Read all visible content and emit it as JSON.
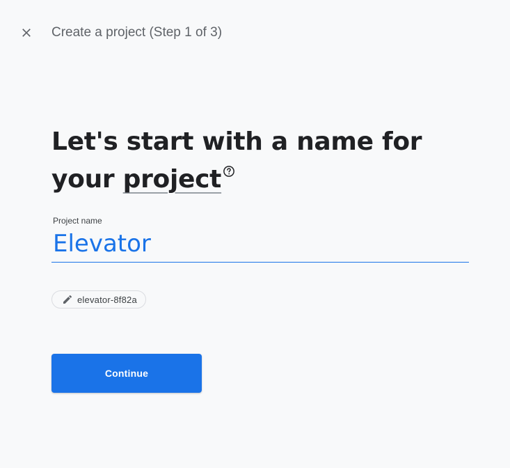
{
  "header": {
    "title": "Create a project (Step 1 of 3)",
    "close_icon": "close-icon"
  },
  "headline": {
    "line1": "Let's start with a name for",
    "line2_prefix": "your ",
    "line2_term": "project",
    "help_icon": "help-circle-icon"
  },
  "project_name": {
    "label": "Project name",
    "value": "Elevator"
  },
  "project_id_chip": {
    "icon": "pencil-icon",
    "value": "elevator-8f82a"
  },
  "actions": {
    "continue_label": "Continue"
  },
  "colors": {
    "accent": "#1a73e8",
    "background": "#f8f9fa",
    "text_primary": "#202124",
    "text_secondary": "#5f6368"
  }
}
